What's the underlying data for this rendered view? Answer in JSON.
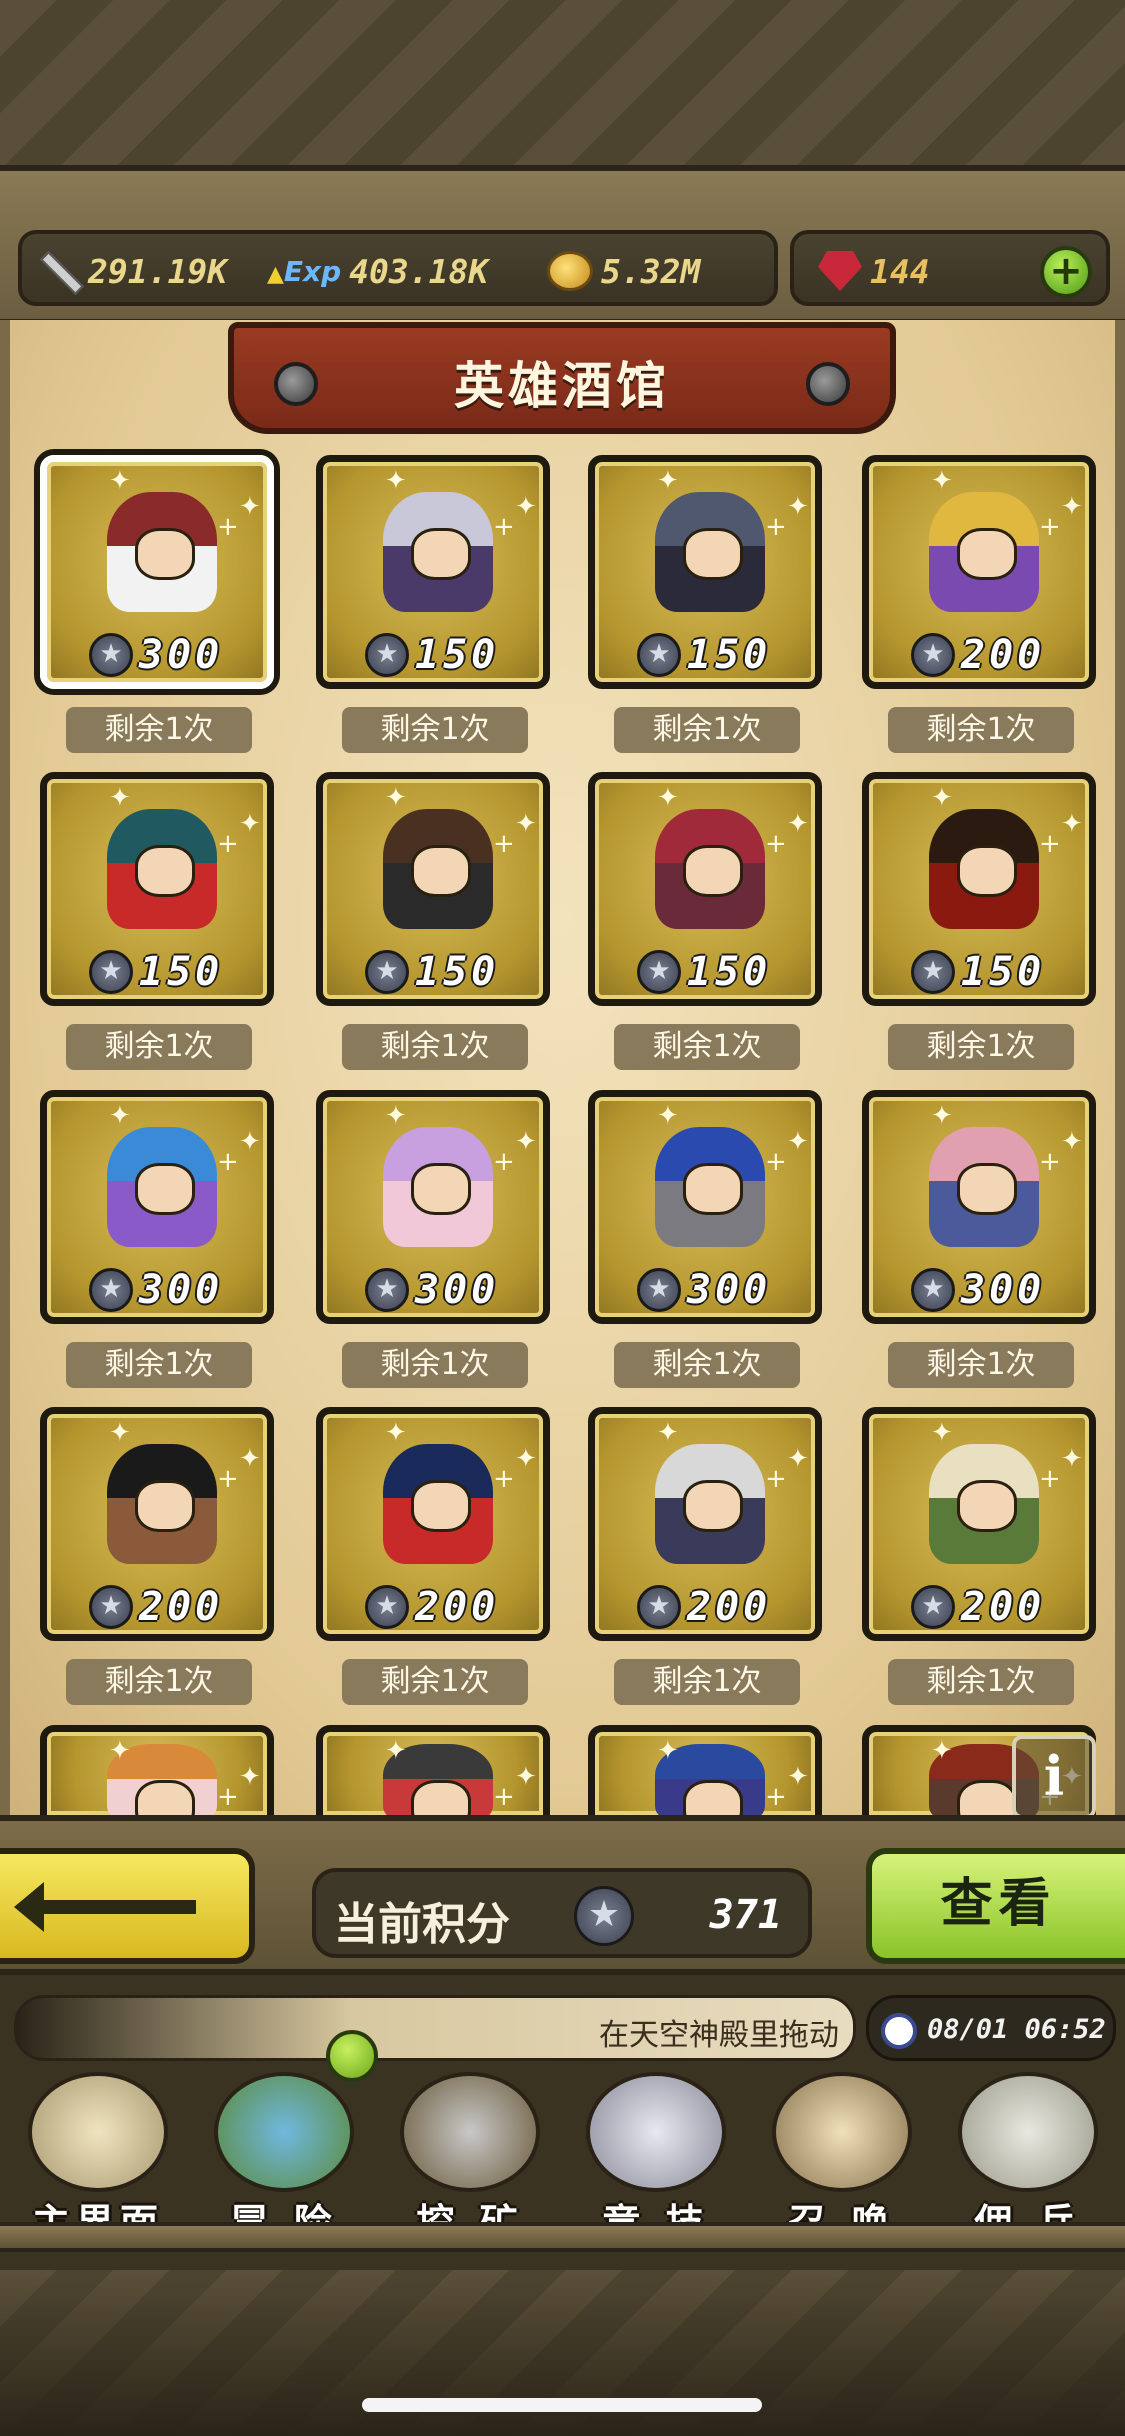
{
  "resources": {
    "power": "291.19K",
    "exp_icon_text": "Exp",
    "exp": "403.18K",
    "gold": "5.32M",
    "gems": "144",
    "add_label": "+"
  },
  "title": "英雄酒馆",
  "heroes": [
    {
      "cost": "300",
      "remain": "剩余1次",
      "selected": true,
      "colors": [
        "#8a2a2a",
        "#f2f2f2"
      ]
    },
    {
      "cost": "150",
      "remain": "剩余1次",
      "colors": [
        "#c8c8d8",
        "#4a3a6a"
      ]
    },
    {
      "cost": "150",
      "remain": "剩余1次",
      "colors": [
        "#505870",
        "#2a2a3a"
      ]
    },
    {
      "cost": "200",
      "remain": "剩余1次",
      "colors": [
        "#e0b840",
        "#7a4ab0"
      ]
    },
    {
      "cost": "150",
      "remain": "剩余1次",
      "colors": [
        "#205a60",
        "#c82a2a"
      ]
    },
    {
      "cost": "150",
      "remain": "剩余1次",
      "colors": [
        "#4a3020",
        "#2a2a2a"
      ]
    },
    {
      "cost": "150",
      "remain": "剩余1次",
      "colors": [
        "#a02a3a",
        "#6a2a3a"
      ]
    },
    {
      "cost": "150",
      "remain": "剩余1次",
      "colors": [
        "#2a1a10",
        "#8a1a10"
      ]
    },
    {
      "cost": "300",
      "remain": "剩余1次",
      "colors": [
        "#3a8ad8",
        "#8a5ac8"
      ]
    },
    {
      "cost": "300",
      "remain": "剩余1次",
      "colors": [
        "#c8a0e0",
        "#f0c8d8"
      ]
    },
    {
      "cost": "300",
      "remain": "剩余1次",
      "colors": [
        "#2a4ab0",
        "#7a7a80"
      ]
    },
    {
      "cost": "300",
      "remain": "剩余1次",
      "colors": [
        "#e0a0b0",
        "#4a5a9a"
      ]
    },
    {
      "cost": "200",
      "remain": "剩余1次",
      "colors": [
        "#1a1a1a",
        "#8a5a3a"
      ]
    },
    {
      "cost": "200",
      "remain": "剩余1次",
      "colors": [
        "#1a2a5a",
        "#c82a2a"
      ]
    },
    {
      "cost": "200",
      "remain": "剩余1次",
      "colors": [
        "#d8d8d8",
        "#3a3a5a"
      ]
    },
    {
      "cost": "200",
      "remain": "剩余1次",
      "colors": [
        "#e8e0c0",
        "#5a7a3a"
      ]
    },
    {
      "cost": "",
      "remain": "",
      "colors": [
        "#d88a3a",
        "#f0d0d0"
      ]
    },
    {
      "cost": "",
      "remain": "",
      "colors": [
        "#3a3a3a",
        "#c83a3a"
      ]
    },
    {
      "cost": "",
      "remain": "",
      "colors": [
        "#2a4aa0",
        "#3a3a8a"
      ]
    },
    {
      "cost": "",
      "remain": "",
      "colors": [
        "#8a2a1a",
        "#5a3a2a"
      ]
    }
  ],
  "info_label": "i",
  "points": {
    "label": "当前积分",
    "value": "371"
  },
  "view_button": "查看",
  "ticker": "在天空神殿里拖动",
  "time": "08/01 06:52",
  "nav": [
    {
      "label": "主界面"
    },
    {
      "label": "冒 险"
    },
    {
      "label": "挖 矿"
    },
    {
      "label": "竞 技"
    },
    {
      "label": "召 唤"
    },
    {
      "label": "佣 兵"
    }
  ]
}
